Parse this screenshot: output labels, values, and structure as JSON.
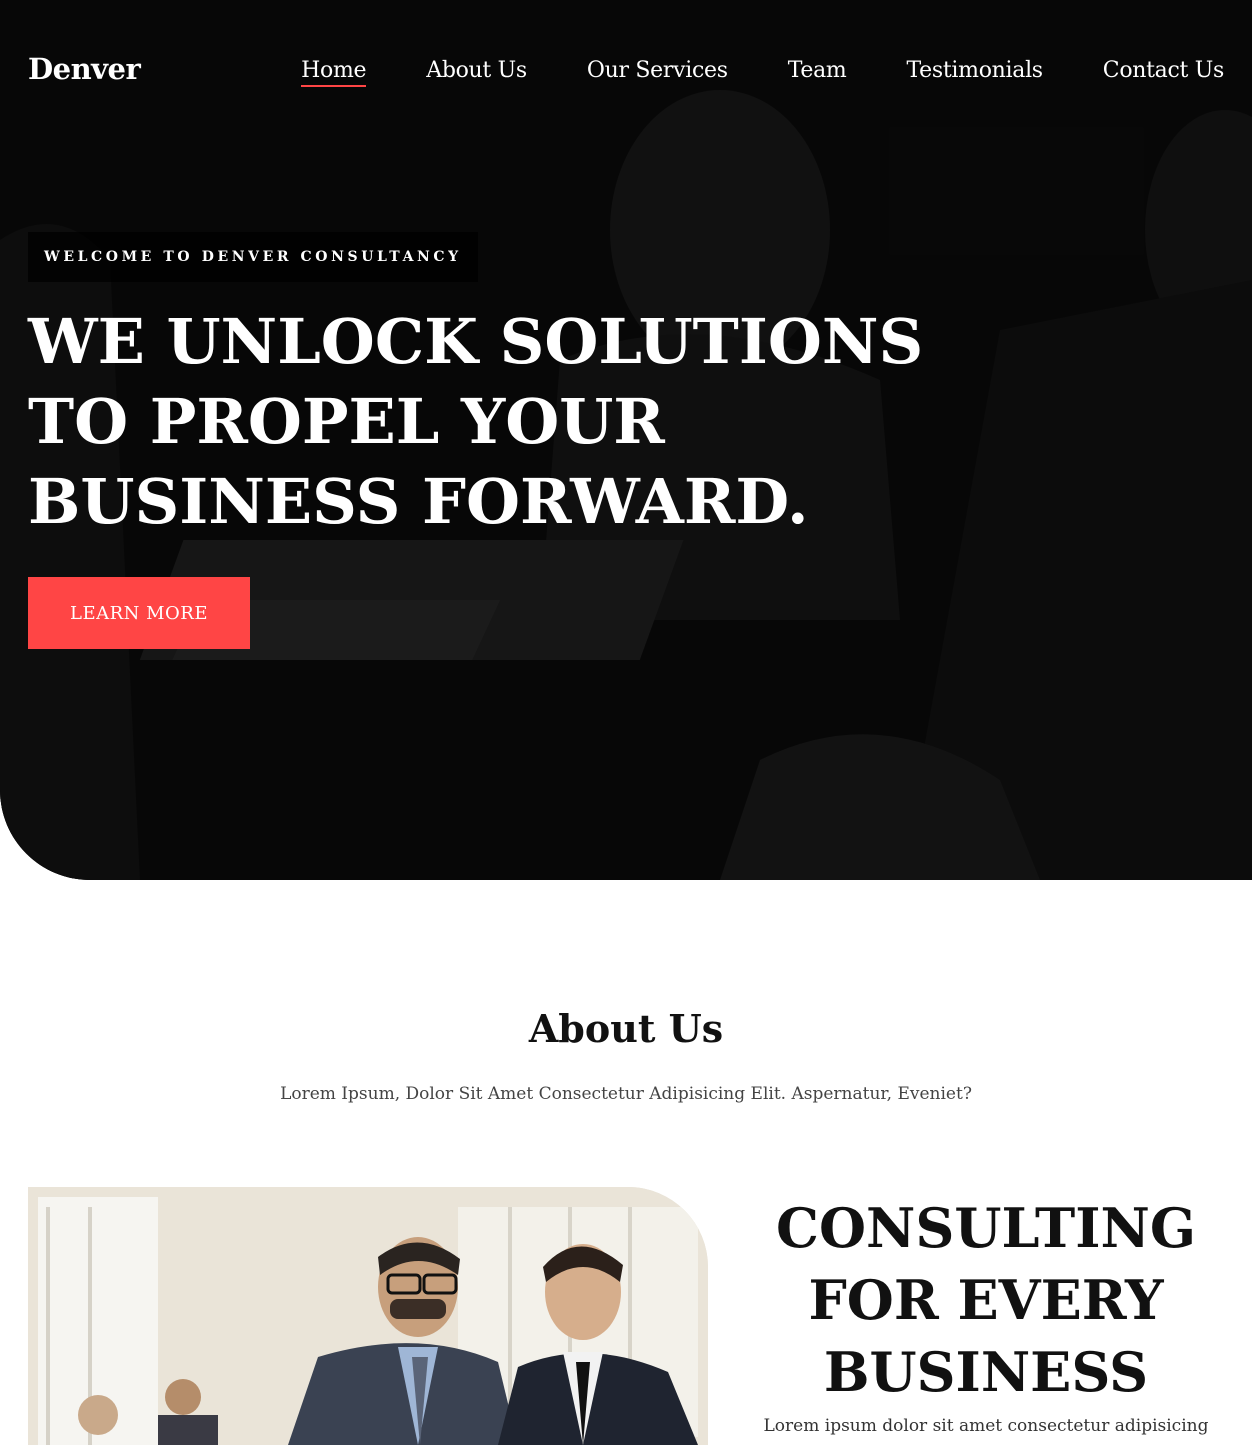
{
  "brand": {
    "name": "Denver",
    "accent": "#ff4545"
  },
  "nav": {
    "items": [
      {
        "label": "Home",
        "active": true
      },
      {
        "label": "About Us",
        "active": false
      },
      {
        "label": "Our Services",
        "active": false
      },
      {
        "label": "Team",
        "active": false
      },
      {
        "label": "Testimonials",
        "active": false
      },
      {
        "label": "Contact Us",
        "active": false
      }
    ]
  },
  "hero": {
    "tagline": "WELCOME TO DENVER CONSULTANCY",
    "title": "WE UNLOCK SOLUTIONS TO PROPEL YOUR BUSINESS FORWARD.",
    "button_label": "LEARN MORE"
  },
  "about": {
    "title": "About Us",
    "subtitle": "Lorem Ipsum, Dolor Sit Amet Consectetur Adipisicing Elit. Aspernatur, Eveniet?",
    "heading": "CONSULTING FOR EVERY BUSINESS",
    "body": "Lorem ipsum dolor sit amet consectetur adipisicing elit. Quibusdam accusamus commodi nihil perferendis."
  }
}
